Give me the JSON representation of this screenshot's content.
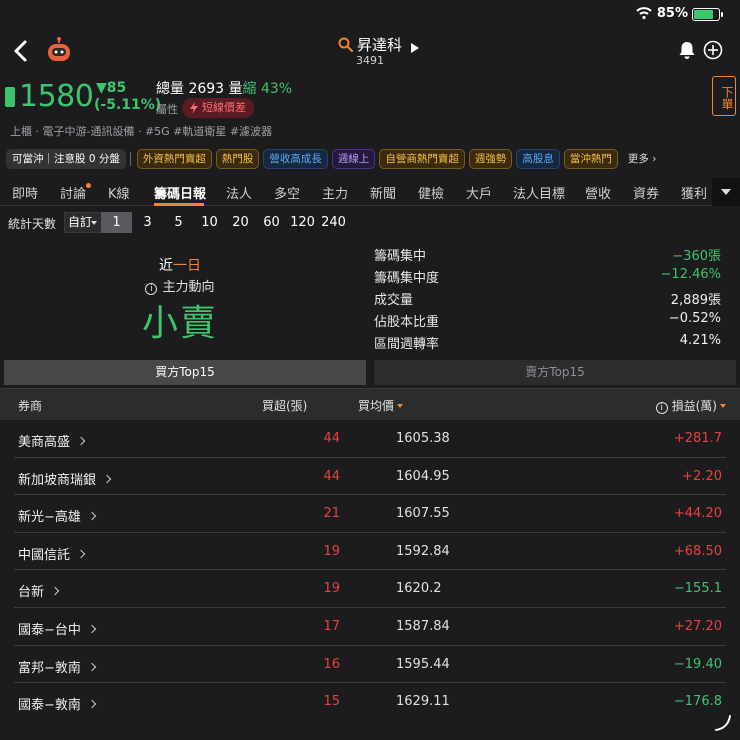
{
  "status": {
    "battery_pct": "85%"
  },
  "header": {
    "stock_name": "昇達科",
    "stock_code": "3491"
  },
  "quote": {
    "price": "1580",
    "change": "▼85",
    "change_pct": "(-5.11%)",
    "volume_text": "總量 2693 量",
    "volume_change": "縮 43%",
    "attr_label": "屬性",
    "attr_tag": "短線價差",
    "sell_button": "下單",
    "industry": "上櫃 · 電子中游-通訊設備 · #5G #軌道衛星 #濾波器"
  },
  "chips": [
    {
      "label": "可當沖｜注意股 0 分盤",
      "style": "dark"
    },
    {
      "label": "外資熱門賣超",
      "style": "gold"
    },
    {
      "label": "熱門股",
      "style": "gold"
    },
    {
      "label": "營收高成長",
      "style": "blue"
    },
    {
      "label": "週線上",
      "style": "purple"
    },
    {
      "label": "自營商熱門賣超",
      "style": "gold"
    },
    {
      "label": "週強勢",
      "style": "gold"
    },
    {
      "label": "高股息",
      "style": "blue"
    },
    {
      "label": "當沖熱門",
      "style": "gold"
    },
    {
      "label": "更多 ›",
      "style": "more"
    }
  ],
  "tabs": [
    "即時",
    "討論",
    "K線",
    "籌碼日報",
    "法人",
    "多空",
    "主力",
    "新聞",
    "健檢",
    "大戶",
    "法人目標",
    "營收",
    "資券",
    "獲利"
  ],
  "active_tab": "籌碼日報",
  "period": {
    "label": "統計天數",
    "custom": "自訂",
    "options": [
      "1",
      "3",
      "5",
      "10",
      "20",
      "60",
      "120",
      "240"
    ],
    "active": "1"
  },
  "summary": {
    "recent_prefix": "近",
    "recent_value": "一日",
    "main_force_label": "主力動向",
    "verdict": "小賣",
    "stats": [
      {
        "label": "籌碼集中",
        "value": "−360張",
        "color": "green"
      },
      {
        "label": "籌碼集中度",
        "value": "−12.46%",
        "color": "green"
      },
      {
        "label": "成交量",
        "value": "2,889張",
        "color": "white"
      },
      {
        "label": "佔股本比重",
        "value": "−0.52%",
        "color": "white"
      },
      {
        "label": "區間週轉率",
        "value": "4.21%",
        "color": "white"
      }
    ]
  },
  "toggle": {
    "buy": "買方Top15",
    "sell": "賣方Top15"
  },
  "table": {
    "headers": {
      "broker": "券商",
      "net_buy": "買超(張)",
      "avg_price": "買均價",
      "pnl": "損益(萬)"
    },
    "rows": [
      {
        "broker": "美商高盛",
        "qty": "44",
        "avg": "1605.38",
        "pl": "+281.7",
        "pl_color": "red"
      },
      {
        "broker": "新加坡商瑞銀",
        "qty": "44",
        "avg": "1604.95",
        "pl": "+2.20",
        "pl_color": "red"
      },
      {
        "broker": "新光−高雄",
        "qty": "21",
        "avg": "1607.55",
        "pl": "+44.20",
        "pl_color": "red"
      },
      {
        "broker": "中國信託",
        "qty": "19",
        "avg": "1592.84",
        "pl": "+68.50",
        "pl_color": "red"
      },
      {
        "broker": "台新",
        "qty": "19",
        "avg": "1620.2",
        "pl": "−155.1",
        "pl_color": "green"
      },
      {
        "broker": "國泰−台中",
        "qty": "17",
        "avg": "1587.84",
        "pl": "+27.20",
        "pl_color": "red"
      },
      {
        "broker": "富邦−敦南",
        "qty": "16",
        "avg": "1595.44",
        "pl": "−19.40",
        "pl_color": "green"
      },
      {
        "broker": "國泰−敦南",
        "qty": "15",
        "avg": "1629.11",
        "pl": "−176.8",
        "pl_color": "green"
      }
    ]
  },
  "colors": {
    "up": "#e8413e",
    "down": "#3ec46d",
    "accent": "#f0862d"
  }
}
